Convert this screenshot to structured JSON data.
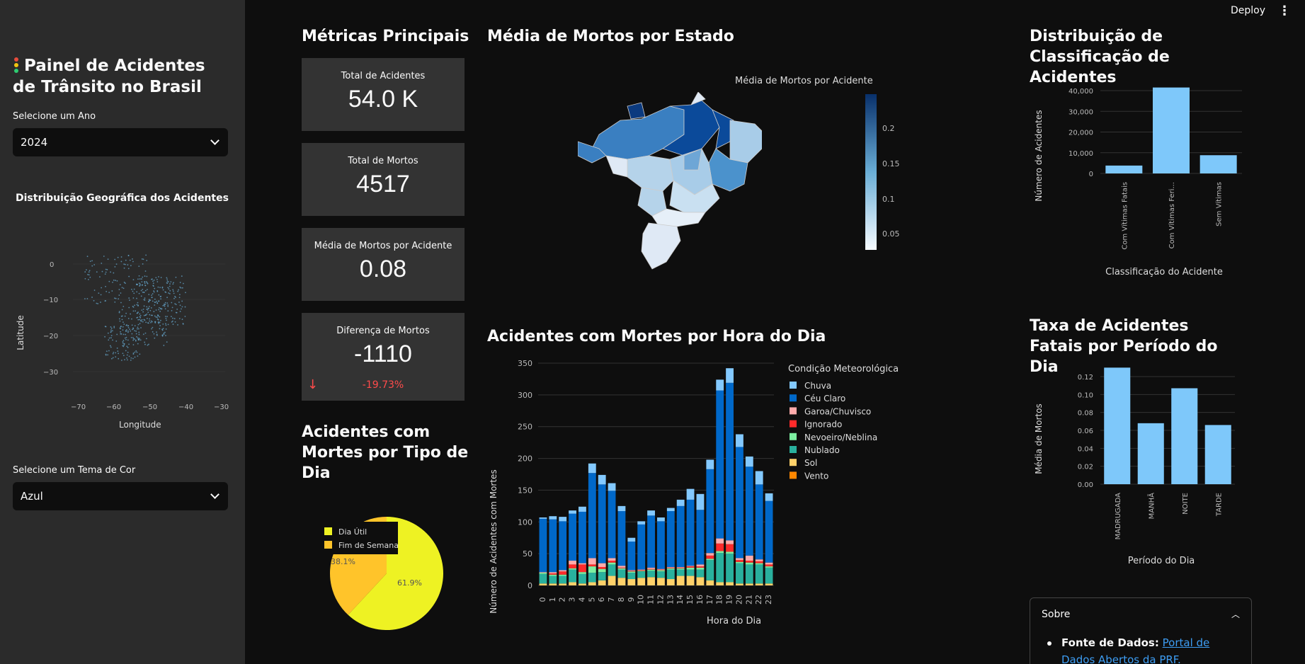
{
  "app": {
    "title": "Painel de Acidentes de Trânsito no Brasil",
    "deploy_label": "Deploy",
    "menu_icon": "kebab-icon"
  },
  "sidebar": {
    "year_label": "Selecione um Ano",
    "year_value": "2024",
    "geo_title": "Distribuição Geográfica dos Acidentes",
    "geo_chart": {
      "xlabel": "Longitude",
      "ylabel": "Latitude",
      "xticks": [
        "−70",
        "−60",
        "−50",
        "−40",
        "−30"
      ],
      "yticks": [
        "0",
        "−10",
        "−20",
        "−30"
      ]
    },
    "theme_label": "Selecione um Tema de Cor",
    "theme_value": "Azul"
  },
  "metrics": {
    "title": "Métricas Principais",
    "total_acidentes": {
      "label": "Total de Acidentes",
      "value": "54.0 K"
    },
    "total_mortos": {
      "label": "Total de Mortos",
      "value": "4517"
    },
    "media_mortos": {
      "label": "Média de Mortos por Acidente",
      "value": "0.08"
    },
    "diferenca": {
      "label": "Diferença de Mortos",
      "value": "-1110",
      "delta": "-19.73%"
    }
  },
  "map": {
    "title": "Média de Mortos por Estado",
    "colorbar_title": "Média de Mortos por Acidente",
    "colorbar_ticks": [
      "0.2",
      "0.15",
      "0.1",
      "0.05"
    ]
  },
  "pie": {
    "title": "Acidentes com Mortes por Tipo de Dia",
    "legend": [
      "Dia Útil",
      "Fim de Semana"
    ],
    "labels": [
      "61.9%",
      "38.1%"
    ]
  },
  "hourly": {
    "title": "Acidentes com Mortes por Hora do Dia",
    "xlabel": "Hora do Dia",
    "ylabel": "Número de Acidentes com Mortes",
    "legend_title": "Condição Meteorológica"
  },
  "classif": {
    "title": "Distribuição de Classificação de Acidentes",
    "xlabel": "Classificação do Acidente",
    "ylabel": "Número de Acidentes"
  },
  "periodo": {
    "title": "Taxa de Acidentes Fatais por Período do Dia",
    "xlabel": "Período do Dia",
    "ylabel": "Média de Mortos"
  },
  "about": {
    "header": "Sobre",
    "source_label": "Fonte de Dados:",
    "source_link": "Portal de Dados Abertos da PRF."
  },
  "colors": {
    "bar_light": "#7ec8fa",
    "chuva": "#83c9ff",
    "ceu_claro": "#0068c9",
    "garoa": "#ffabab",
    "ignorado": "#ff2b2b",
    "nevoeiro": "#7defa1",
    "nublado": "#29b09d",
    "sol": "#ffd16a",
    "vento": "#ff8700",
    "pie_dia_util": "#eef223",
    "pie_fim_semana": "#ffc42a",
    "delta_negative": "#ff4b4b"
  },
  "chart_data": [
    {
      "type": "pie",
      "title": "Acidentes com Mortes por Tipo de Dia",
      "labels": [
        "Dia Útil",
        "Fim de Semana"
      ],
      "values": [
        61.9,
        38.1
      ]
    },
    {
      "type": "bar",
      "stacked": true,
      "title": "Acidentes com Mortes por Hora do Dia",
      "xlabel": "Hora do Dia",
      "ylabel": "Número de Acidentes com Mortes",
      "ylim": [
        0,
        350
      ],
      "yticks": [
        0,
        50,
        100,
        150,
        200,
        250,
        300,
        350
      ],
      "categories": [
        "0",
        "1",
        "2",
        "3",
        "4",
        "5",
        "6",
        "7",
        "8",
        "9",
        "10",
        "11",
        "12",
        "13",
        "14",
        "15",
        "16",
        "17",
        "18",
        "19",
        "20",
        "21",
        "22",
        "23"
      ],
      "series": [
        {
          "name": "Vento",
          "values": [
            0,
            0,
            0,
            0,
            0,
            0,
            0,
            0,
            0,
            0,
            0,
            0,
            0,
            0,
            0,
            0,
            0,
            0,
            0,
            0,
            0,
            0,
            0,
            0
          ]
        },
        {
          "name": "Sol",
          "values": [
            3,
            3,
            3,
            5,
            3,
            5,
            8,
            15,
            12,
            10,
            12,
            13,
            12,
            10,
            15,
            15,
            13,
            8,
            5,
            5,
            3,
            3,
            3,
            3
          ]
        },
        {
          "name": "Nublado",
          "values": [
            15,
            12,
            12,
            20,
            15,
            15,
            13,
            18,
            13,
            10,
            10,
            10,
            10,
            15,
            10,
            10,
            12,
            32,
            46,
            45,
            32,
            30,
            30,
            25
          ]
        },
        {
          "name": "Nevoeiro/Neblina",
          "values": [
            2,
            2,
            2,
            2,
            3,
            10,
            5,
            3,
            2,
            2,
            1,
            2,
            2,
            2,
            2,
            3,
            3,
            2,
            3,
            3,
            2,
            3,
            2,
            2
          ]
        },
        {
          "name": "Ignorado",
          "values": [
            0,
            2,
            5,
            6,
            12,
            3,
            3,
            3,
            1,
            1,
            1,
            1,
            1,
            1,
            1,
            2,
            2,
            5,
            12,
            12,
            3,
            3,
            3,
            3
          ]
        },
        {
          "name": "Garoa/Chuvisco",
          "values": [
            1,
            2,
            2,
            6,
            2,
            10,
            6,
            4,
            3,
            1,
            1,
            2,
            1,
            1,
            1,
            1,
            3,
            4,
            8,
            6,
            3,
            8,
            3,
            3
          ]
        },
        {
          "name": "Céu Claro",
          "values": [
            84,
            83,
            77,
            74,
            81,
            134,
            124,
            106,
            86,
            45,
            71,
            82,
            75,
            88,
            96,
            104,
            86,
            132,
            233,
            248,
            175,
            140,
            118,
            97
          ]
        },
        {
          "name": "Chuva",
          "values": [
            2,
            5,
            7,
            5,
            8,
            15,
            15,
            12,
            8,
            6,
            5,
            8,
            6,
            5,
            10,
            17,
            25,
            15,
            17,
            23,
            20,
            16,
            21,
            12
          ]
        }
      ]
    },
    {
      "type": "bar",
      "title": "Distribuição de Classificação de Acidentes",
      "xlabel": "Classificação do Acidente",
      "ylabel": "Número de Acidentes",
      "categories": [
        "Com Vítimas Fatais",
        "Com Vítimas Feri...",
        "Sem Vítimas"
      ],
      "values": [
        3800,
        41500,
        8800
      ],
      "ylim": [
        0,
        40000
      ],
      "yticks": [
        0,
        10000,
        20000,
        30000,
        40000
      ]
    },
    {
      "type": "bar",
      "title": "Taxa de Acidentes Fatais por Período do Dia",
      "xlabel": "Período do Dia",
      "ylabel": "Média de Mortos",
      "categories": [
        "MADRUGADA",
        "MANHÃ",
        "NOITE",
        "TARDE"
      ],
      "values": [
        0.13,
        0.068,
        0.107,
        0.066
      ],
      "ylim": [
        0,
        0.12
      ],
      "yticks": [
        0,
        0.02,
        0.04,
        0.06,
        0.08,
        0.1,
        0.12
      ]
    }
  ]
}
